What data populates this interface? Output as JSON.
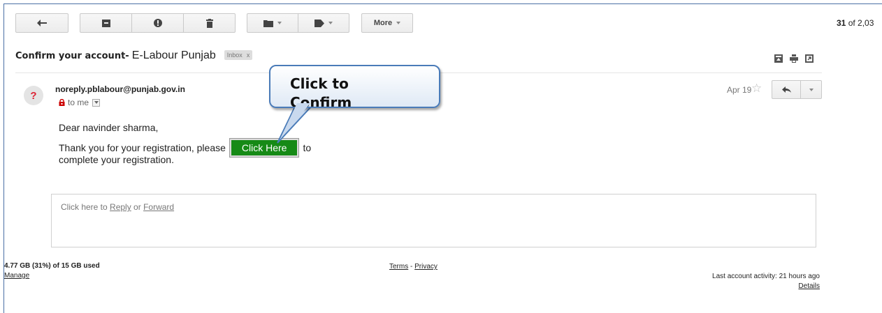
{
  "toolbar": {
    "more_label": "More",
    "pager_current": "31",
    "pager_rest": " of 2,03"
  },
  "message": {
    "subject_bold": "Confirm your account-",
    "subject_plain": "E-Labour Punjab",
    "label_tag": "Inbox",
    "label_remove": "x",
    "sender": "noreply.pblabour@punjab.gov.in",
    "recipient": "to me",
    "date": "Apr 19",
    "avatar_glyph": "?",
    "greeting": "Dear navinder sharma,",
    "line_before_button": "Thank you for your registration, please",
    "button_label": "Click Here",
    "line_after_button": "to",
    "line_last": "complete your registration."
  },
  "callout": {
    "text": "Click to Confirm"
  },
  "reply_box": {
    "prefix": "Click here to ",
    "reply_link": "Reply",
    "middle": " or ",
    "forward_link": "Forward"
  },
  "footer": {
    "storage": "4.77 GB (31%) of 15 GB used",
    "manage": "Manage",
    "terms": "Terms",
    "separator": " - ",
    "privacy": "Privacy",
    "last_activity": "Last account activity: 21 hours ago",
    "details": "Details"
  },
  "icons": [
    "back-arrow-icon",
    "archive-icon",
    "report-spam-icon",
    "delete-icon",
    "folder-icon",
    "label-icon",
    "print-icon",
    "new-window-icon",
    "expand-all-icon",
    "lock-icon",
    "star-icon",
    "reply-icon"
  ],
  "colors": {
    "button_green": "#168a16",
    "callout_border": "#4a7bb8",
    "avatar_mark": "#dd2233"
  }
}
